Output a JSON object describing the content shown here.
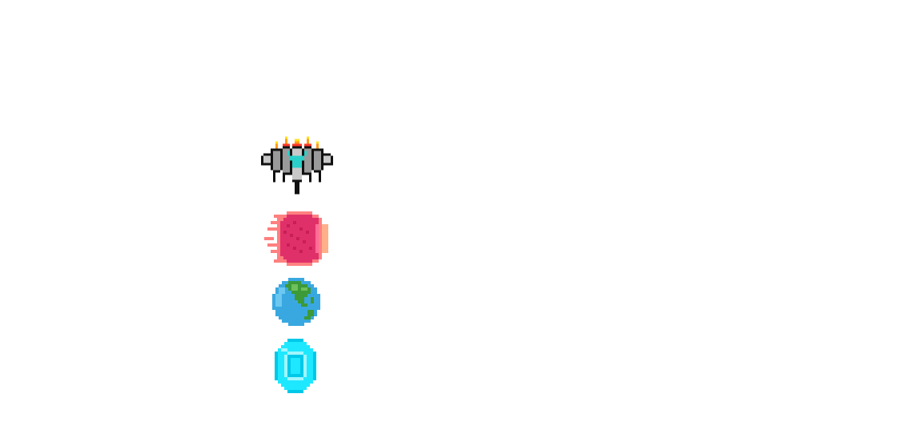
{
  "scene": {
    "background": "#ffffff",
    "sprites": [
      {
        "id": "ship",
        "name": "spaceship-icon",
        "description_color": "#9e9e9e"
      },
      {
        "id": "meteor",
        "name": "meteor-icon",
        "description_color": "#e0306a"
      },
      {
        "id": "earth",
        "name": "earth-planet-icon",
        "description_color": "#3aa8e0"
      },
      {
        "id": "gem",
        "name": "cyan-crystal-icon",
        "description_color": "#1ee8ff"
      }
    ]
  },
  "palette": {
    "outline": "#111111",
    "hull": "#9a9a9a",
    "hull_light": "#c8c8c8",
    "cockpit": "#2ad0c8",
    "flame_red": "#ff3a2a",
    "flame_orange": "#ff9a1a",
    "flame_yellow": "#ffe21a",
    "meteor_core": "#e0306a",
    "meteor_dark": "#c81e55",
    "meteor_glow": "#ff8080",
    "meteor_edge": "#ffb08a",
    "ocean": "#3aa8e0",
    "ocean_light": "#6cc8f0",
    "land": "#3c9a38",
    "land_light": "#6ec05a",
    "gem_light": "#9ff6ff",
    "gem_mid": "#1ee8ff",
    "gem_dark": "#00c8e8"
  }
}
